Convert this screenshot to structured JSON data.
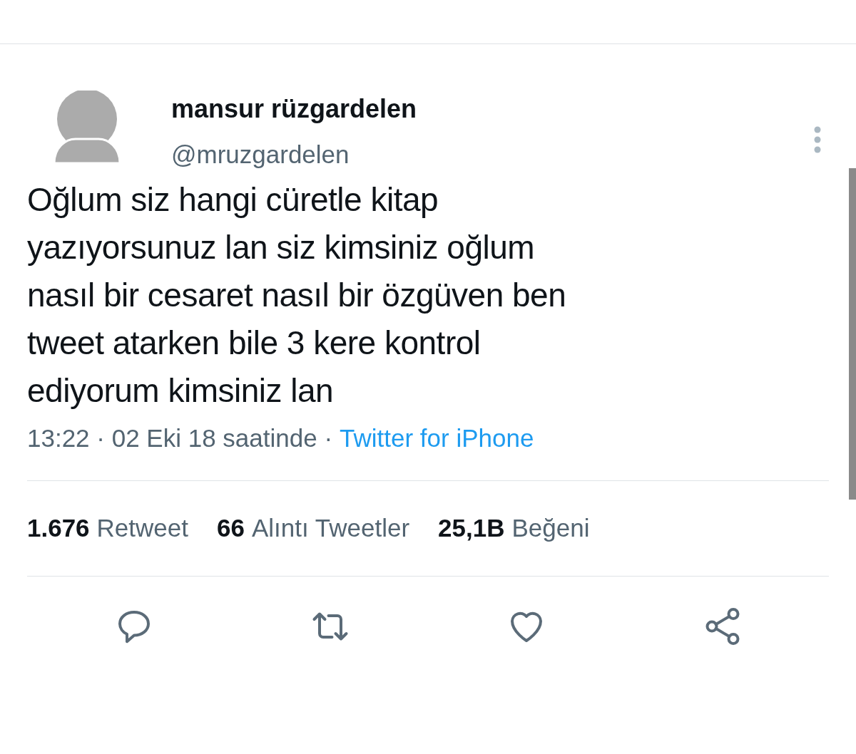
{
  "author": {
    "name": "mansur rüzgardelen",
    "handle": "@mruzgardelen"
  },
  "tweet_lines": [
    "Oğlum siz hangi cüretle kitap",
    "yazıyorsunuz lan siz kimsiniz oğlum",
    "nasıl bir cesaret nasıl bir özgüven ben",
    "tweet atarken bile 3 kere kontrol",
    "ediyorum kimsiniz lan"
  ],
  "meta": {
    "time": "13:22 · 02 Eki 18 saatinde ·",
    "source": "Twitter for iPhone"
  },
  "stats": [
    {
      "count": "1.676",
      "label": "Retweet"
    },
    {
      "count": "66",
      "label": "Alıntı Tweetler"
    },
    {
      "count": "25,1B",
      "label": "Beğeni"
    }
  ],
  "actions": [
    {
      "kind": "reply"
    },
    {
      "kind": "retweet"
    },
    {
      "kind": "like"
    },
    {
      "kind": "share"
    }
  ]
}
